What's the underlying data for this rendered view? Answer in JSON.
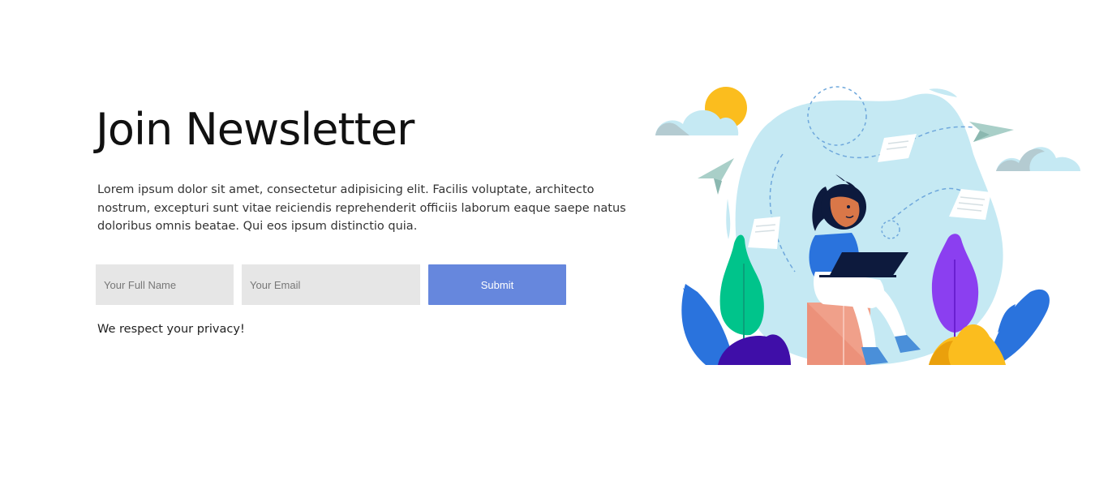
{
  "newsletter": {
    "title": "Join Newsletter",
    "description": "Lorem ipsum dolor sit amet, consectetur adipisicing elit. Facilis voluptate, architecto nostrum, excepturi sunt vitae reiciendis reprehenderit officiis laborum eaque saepe natus doloribus omnis beatae. Qui eos ipsum distinctio quia.",
    "privacy_note": "We respect your privacy!"
  },
  "form": {
    "name_placeholder": "Your Full Name",
    "email_placeholder": "Your Email",
    "submit_label": "Submit"
  },
  "colors": {
    "accent": "#6687dd",
    "input_bg": "#e6e6e6"
  }
}
